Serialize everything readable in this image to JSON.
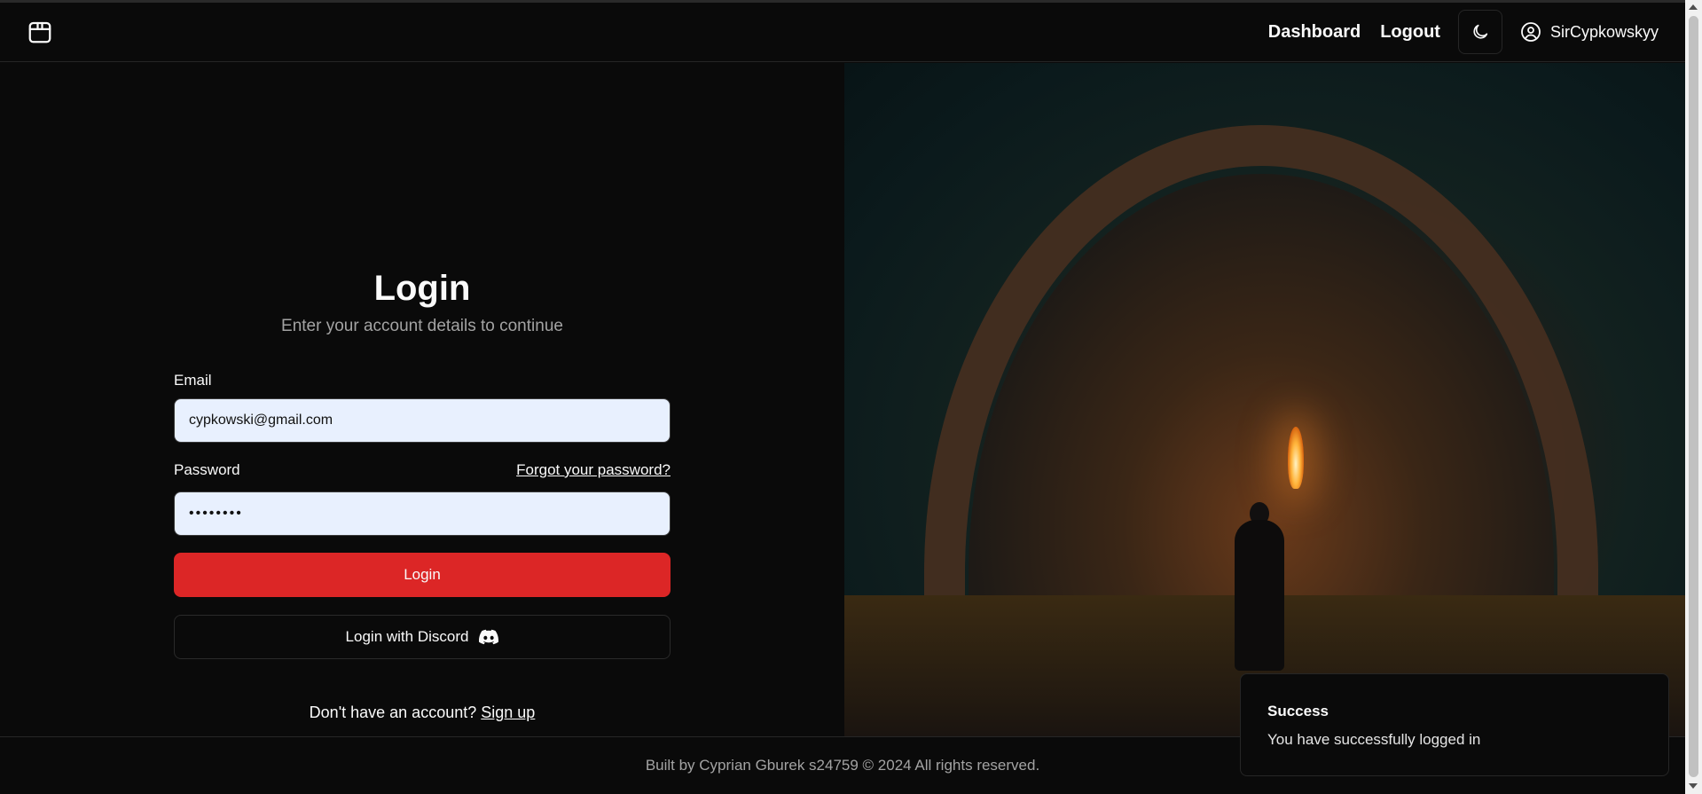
{
  "header": {
    "logo_icon": "package-icon",
    "nav": {
      "dashboard_label": "Dashboard",
      "logout_label": "Logout"
    },
    "theme_toggle_icon": "moon-icon",
    "user": {
      "icon": "user-circle-icon",
      "name": "SirCypkowskyy"
    }
  },
  "login_form": {
    "title": "Login",
    "subtitle": "Enter your account details to continue",
    "email": {
      "label": "Email",
      "value": "cypkowski@gmail.com"
    },
    "password": {
      "label": "Password",
      "forgot_link": "Forgot your password?",
      "value": "••••••••"
    },
    "login_button": "Login",
    "discord_button": "Login with Discord",
    "discord_icon": "discord-icon",
    "signup_prompt": "Don't have an account?",
    "signup_link": "Sign up"
  },
  "footer": {
    "text": "Built by Cyprian Gburek s24759 © 2024 All rights reserved."
  },
  "toast": {
    "title": "Success",
    "message": "You have successfully logged in"
  },
  "colors": {
    "background": "#0a0a0a",
    "primary": "#dc2626",
    "input_fill": "#e8f0fe",
    "muted_text": "#a3a3a3"
  }
}
